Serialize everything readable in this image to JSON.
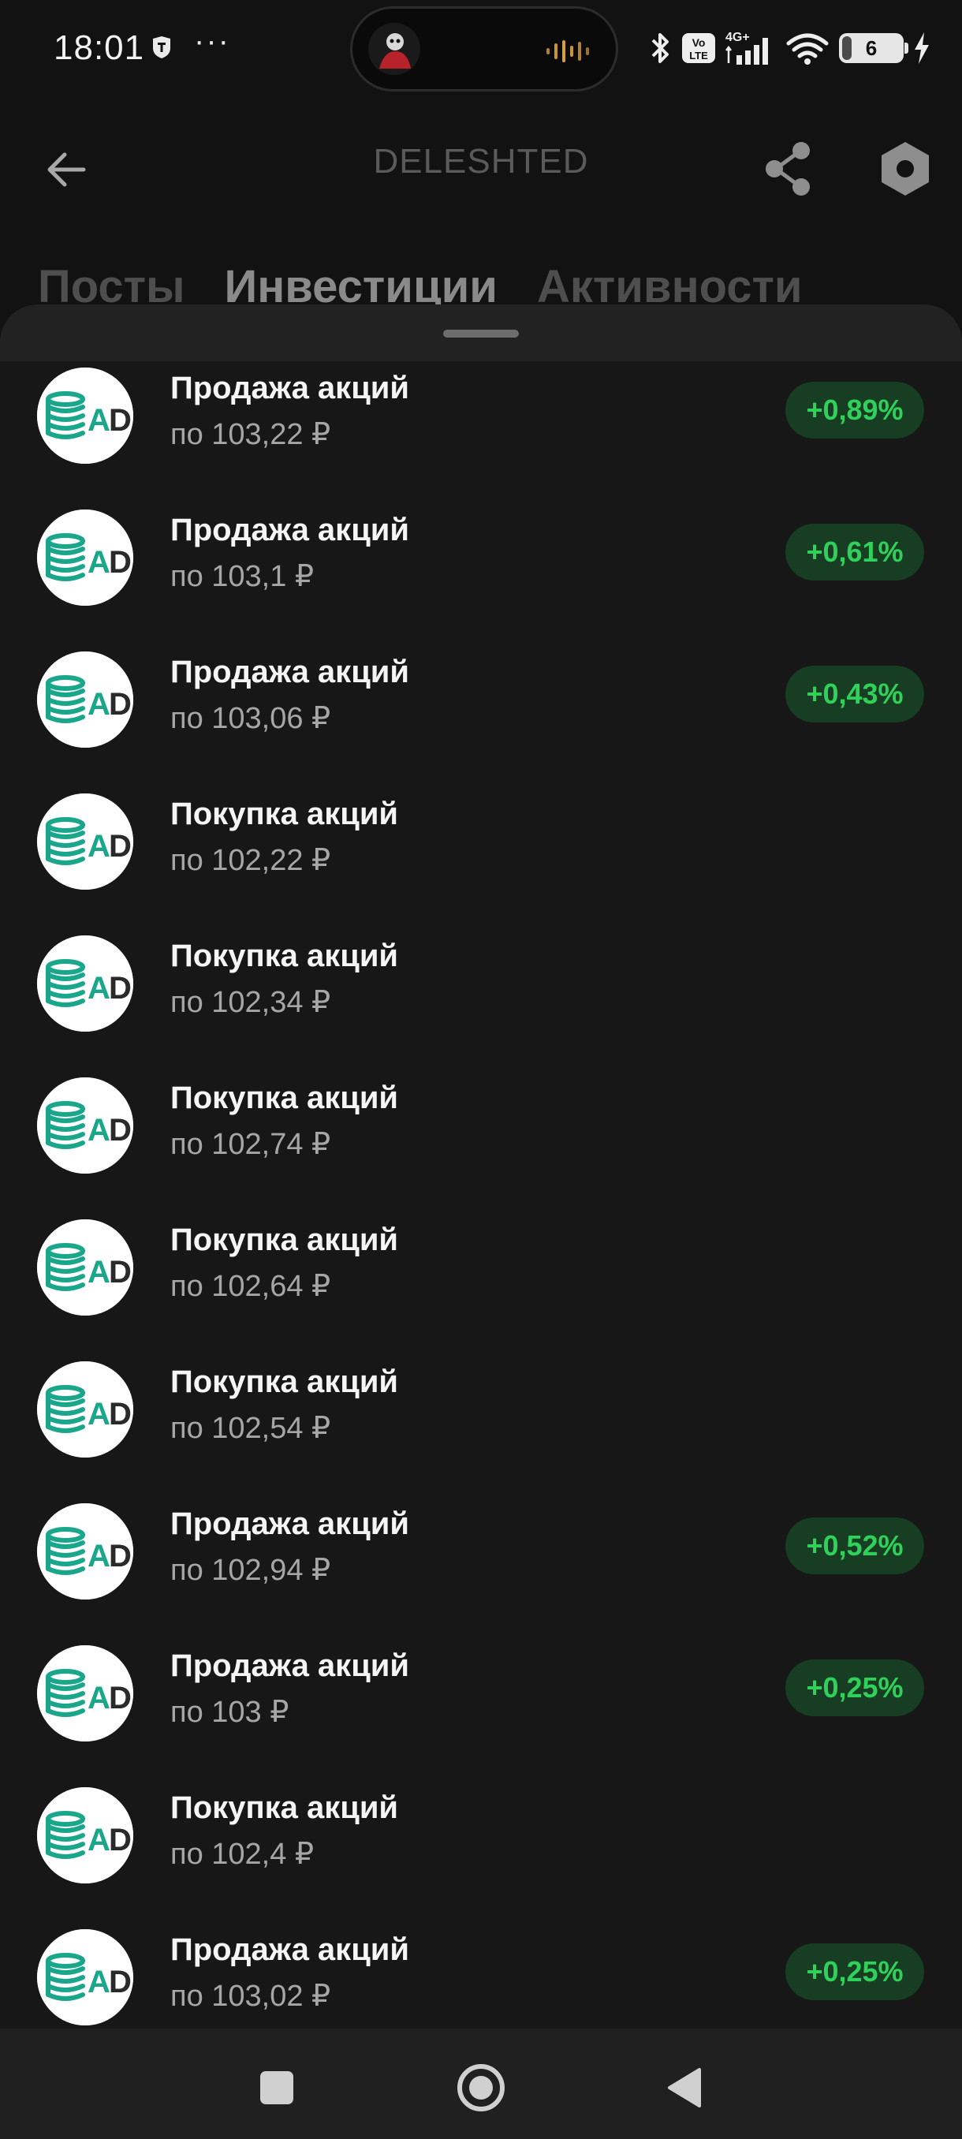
{
  "status_bar": {
    "time": "18:01",
    "more": "···",
    "battery_level": "6",
    "icons": [
      "shield-badge-icon",
      "bluetooth-icon",
      "volte-icon",
      "signal-icon",
      "wifi-icon",
      "battery-icon",
      "charging-icon"
    ]
  },
  "header": {
    "title": "DELESHTED",
    "back_icon": "arrow-left-icon",
    "share_icon": "share-icon",
    "settings_icon": "hexagon-settings-icon"
  },
  "tabs": [
    {
      "label": "Посты",
      "active": false
    },
    {
      "label": "Инвестиции",
      "active": true
    },
    {
      "label": "Активности",
      "active": false
    }
  ],
  "colors": {
    "background": "#121212",
    "sheet": "#171717",
    "positive_text": "#2fd15a",
    "positive_bg": "#173e22",
    "logo_teal": "#1aa68a"
  },
  "logo_text": "AD",
  "operations": [
    {
      "title": "Продажа акций",
      "price": "по 103,22 ₽",
      "change": "+0,89%"
    },
    {
      "title": "Продажа акций",
      "price": "по 103,1 ₽",
      "change": "+0,61%"
    },
    {
      "title": "Продажа акций",
      "price": "по 103,06 ₽",
      "change": "+0,43%"
    },
    {
      "title": "Покупка акций",
      "price": "по 102,22 ₽",
      "change": ""
    },
    {
      "title": "Покупка акций",
      "price": "по 102,34 ₽",
      "change": ""
    },
    {
      "title": "Покупка акций",
      "price": "по 102,74 ₽",
      "change": ""
    },
    {
      "title": "Покупка акций",
      "price": "по 102,64 ₽",
      "change": ""
    },
    {
      "title": "Покупка акций",
      "price": "по 102,54 ₽",
      "change": ""
    },
    {
      "title": "Продажа акций",
      "price": "по 102,94 ₽",
      "change": "+0,52%"
    },
    {
      "title": "Продажа акций",
      "price": "по 103 ₽",
      "change": "+0,25%"
    },
    {
      "title": "Покупка акций",
      "price": "по 102,4 ₽",
      "change": ""
    },
    {
      "title": "Продажа акций",
      "price": "по 103,02 ₽",
      "change": "+0,25%"
    }
  ],
  "navbar": {
    "recents_icon": "square-icon",
    "home_icon": "circle-home-icon",
    "back_icon": "triangle-back-icon"
  }
}
